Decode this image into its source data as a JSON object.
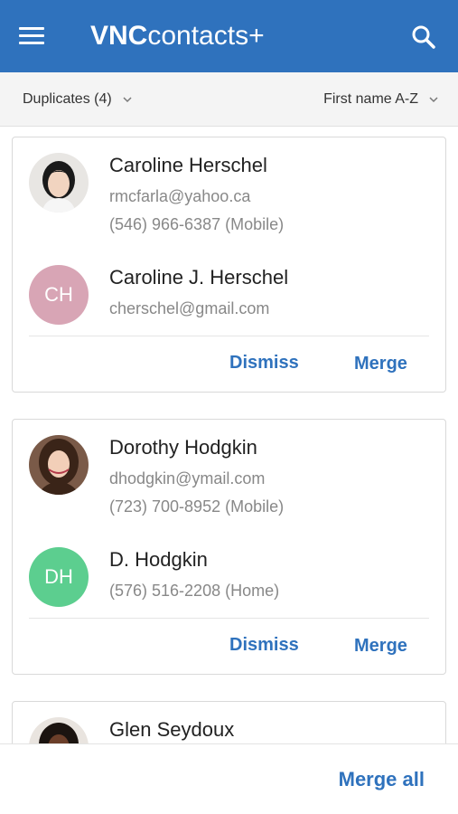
{
  "app": {
    "logo_bold": "VNC",
    "logo_rest": "contacts+"
  },
  "filters": {
    "group": "Duplicates (4)",
    "sort": "First name A-Z"
  },
  "groups": [
    {
      "contacts": [
        {
          "name": "Caroline Herschel",
          "email": "rmcfarla@yahoo.ca",
          "phone": "(546) 966-6387 (Mobile)",
          "avatar": "photo"
        },
        {
          "name": "Caroline J. Herschel",
          "email": "cherschel@gmail.com",
          "initials": "CH",
          "avatar_color": "#d8a5b5"
        }
      ],
      "dismiss": "Dismiss",
      "merge": "Merge"
    },
    {
      "contacts": [
        {
          "name": "Dorothy Hodgkin",
          "email": "dhodgkin@ymail.com",
          "phone": "(723) 700-8952 (Mobile)",
          "avatar": "photo"
        },
        {
          "name": "D. Hodgkin",
          "phone": "(576) 516-2208 (Home)",
          "initials": "DH",
          "avatar_color": "#5cce8f"
        }
      ],
      "dismiss": "Dismiss",
      "merge": "Merge"
    },
    {
      "contacts": [
        {
          "name": "Glen Seydoux",
          "avatar": "photo"
        }
      ]
    }
  ],
  "footer": {
    "merge_all": "Merge all"
  },
  "colors": {
    "primary": "#2f72bd",
    "ch_avatar": "#d8a5b5",
    "dh_avatar": "#5cce8f"
  }
}
